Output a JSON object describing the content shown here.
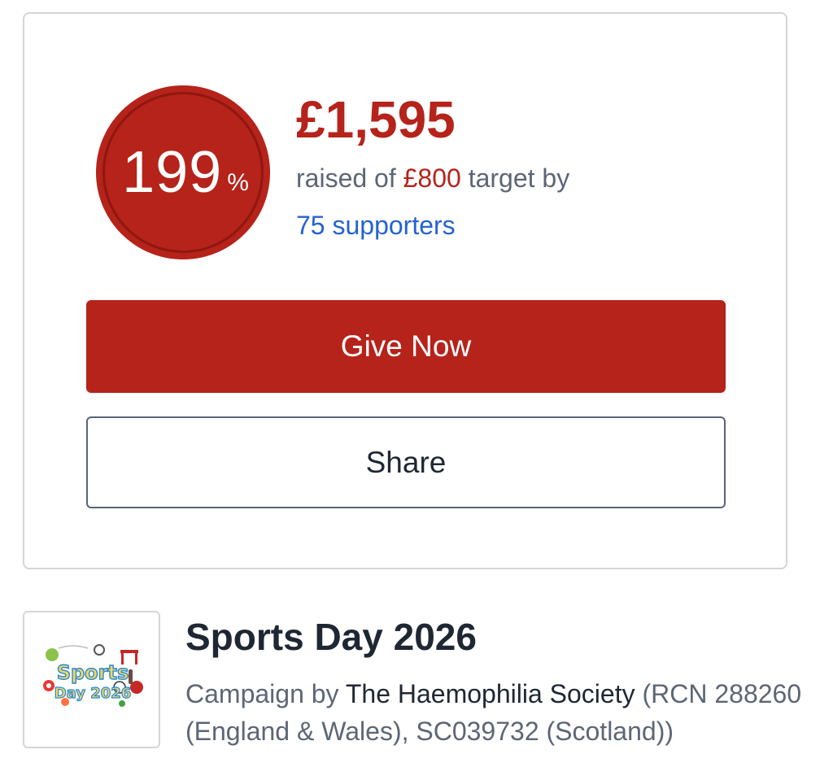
{
  "donation": {
    "progress_percent": "199",
    "percent_symbol": "%",
    "progress_fraction": 1.99,
    "amount_raised": "£1,595",
    "raised_prefix": "raised of",
    "target_amount": "£800",
    "raised_suffix": "target by",
    "supporters": "75 supporters",
    "give_label": "Give Now",
    "share_label": "Share"
  },
  "campaign": {
    "logo_line1": "Sports",
    "logo_line2": "Day 2026",
    "title": "Sports Day 2026",
    "by_prefix": "Campaign by",
    "organization": "The Haemophilia Society",
    "registration": "(RCN 288260 (England & Wales), SC039732 (Scotland))"
  },
  "colors": {
    "accent_red": "#b5231a",
    "link_blue": "#2563d0",
    "muted_text": "#5d6675",
    "dark_text": "#1f2733"
  }
}
